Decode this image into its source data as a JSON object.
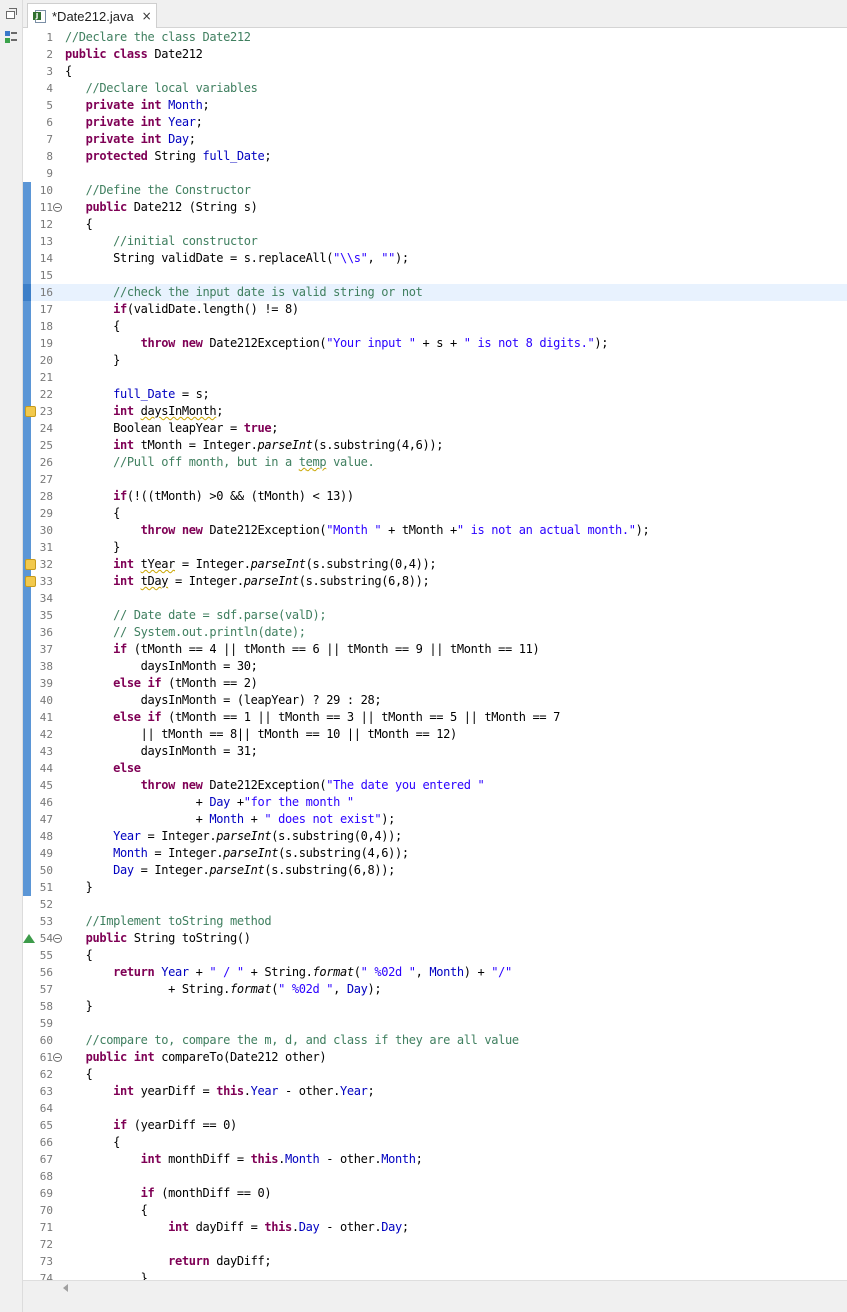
{
  "tab": {
    "title": "*Date212.java",
    "close": "×"
  },
  "lines": [
    {
      "n": "1",
      "code": [
        [
          "cm",
          "//Declare the class Date212"
        ]
      ]
    },
    {
      "n": "2",
      "code": [
        [
          "kw",
          "public"
        ],
        [
          "",
          " "
        ],
        [
          "kw",
          "class"
        ],
        [
          "",
          " Date212"
        ]
      ]
    },
    {
      "n": "3",
      "code": [
        [
          "",
          "{"
        ]
      ]
    },
    {
      "n": "4",
      "code": [
        [
          "",
          "   "
        ],
        [
          "cm",
          "//Declare local variables"
        ]
      ]
    },
    {
      "n": "5",
      "code": [
        [
          "",
          "   "
        ],
        [
          "kw",
          "private"
        ],
        [
          "",
          " "
        ],
        [
          "kw",
          "int"
        ],
        [
          "",
          " "
        ],
        [
          "fd",
          "Month"
        ],
        [
          "",
          ";"
        ]
      ]
    },
    {
      "n": "6",
      "code": [
        [
          "",
          "   "
        ],
        [
          "kw",
          "private"
        ],
        [
          "",
          " "
        ],
        [
          "kw",
          "int"
        ],
        [
          "",
          " "
        ],
        [
          "fd",
          "Year"
        ],
        [
          "",
          ";"
        ]
      ]
    },
    {
      "n": "7",
      "code": [
        [
          "",
          "   "
        ],
        [
          "kw",
          "private"
        ],
        [
          "",
          " "
        ],
        [
          "kw",
          "int"
        ],
        [
          "",
          " "
        ],
        [
          "fd",
          "Day"
        ],
        [
          "",
          ";"
        ]
      ]
    },
    {
      "n": "8",
      "code": [
        [
          "",
          "   "
        ],
        [
          "kw",
          "protected"
        ],
        [
          "",
          " String "
        ],
        [
          "fd",
          "full_Date"
        ],
        [
          "",
          ";"
        ]
      ]
    },
    {
      "n": "9",
      "code": []
    },
    {
      "n": "10",
      "code": [
        [
          "",
          "   "
        ],
        [
          "cm",
          "//Define the Constructor"
        ]
      ]
    },
    {
      "n": "11",
      "code": [
        [
          "",
          "   "
        ],
        [
          "kw",
          "public"
        ],
        [
          "",
          " Date212 (String s)"
        ]
      ]
    },
    {
      "n": "12",
      "code": [
        [
          "",
          "   {"
        ]
      ]
    },
    {
      "n": "13",
      "code": [
        [
          "",
          "       "
        ],
        [
          "cm",
          "//initial constructor"
        ]
      ]
    },
    {
      "n": "14",
      "code": [
        [
          "",
          "       String validDate = s.replaceAll("
        ],
        [
          "st",
          "\"\\\\s\""
        ],
        [
          "",
          ", "
        ],
        [
          "st",
          "\"\""
        ],
        [
          "",
          ");"
        ]
      ]
    },
    {
      "n": "15",
      "code": []
    },
    {
      "n": "16",
      "code": [
        [
          "",
          "       "
        ],
        [
          "cm",
          "//check the input date is valid string or not"
        ]
      ]
    },
    {
      "n": "17",
      "code": [
        [
          "",
          "       "
        ],
        [
          "kw",
          "if"
        ],
        [
          "",
          "(validDate.length() != 8)"
        ]
      ]
    },
    {
      "n": "18",
      "code": [
        [
          "",
          "       {"
        ]
      ]
    },
    {
      "n": "19",
      "code": [
        [
          "",
          "           "
        ],
        [
          "kw",
          "throw"
        ],
        [
          "",
          " "
        ],
        [
          "kw",
          "new"
        ],
        [
          "",
          " Date212Exception("
        ],
        [
          "st",
          "\"Your input \""
        ],
        [
          "",
          " + s + "
        ],
        [
          "st",
          "\" is not 8 digits.\""
        ],
        [
          "",
          ");"
        ]
      ]
    },
    {
      "n": "20",
      "code": [
        [
          "",
          "       }"
        ]
      ]
    },
    {
      "n": "21",
      "code": []
    },
    {
      "n": "22",
      "code": [
        [
          "",
          "       "
        ],
        [
          "fd",
          "full_Date"
        ],
        [
          "",
          " = s;"
        ]
      ]
    },
    {
      "n": "23",
      "code": [
        [
          "",
          "       "
        ],
        [
          "kw",
          "int"
        ],
        [
          "",
          " "
        ],
        [
          "sq",
          "daysInMonth"
        ],
        [
          "",
          ";"
        ]
      ]
    },
    {
      "n": "24",
      "code": [
        [
          "",
          "       Boolean leapYear = "
        ],
        [
          "kw",
          "true"
        ],
        [
          "",
          ";"
        ]
      ]
    },
    {
      "n": "25",
      "code": [
        [
          "",
          "       "
        ],
        [
          "kw",
          "int"
        ],
        [
          "",
          " tMonth = Integer."
        ],
        [
          "it",
          "parseInt"
        ],
        [
          "",
          "(s.substring(4,6));"
        ]
      ]
    },
    {
      "n": "26",
      "code": [
        [
          "",
          "       "
        ],
        [
          "cm",
          "//Pull off month, but in a "
        ],
        [
          "cm sq",
          "temp"
        ],
        [
          "cm",
          " value."
        ]
      ]
    },
    {
      "n": "27",
      "code": []
    },
    {
      "n": "28",
      "code": [
        [
          "",
          "       "
        ],
        [
          "kw",
          "if"
        ],
        [
          "",
          "(!((tMonth) >0 && (tMonth) < 13))"
        ]
      ]
    },
    {
      "n": "29",
      "code": [
        [
          "",
          "       {"
        ]
      ]
    },
    {
      "n": "30",
      "code": [
        [
          "",
          "           "
        ],
        [
          "kw",
          "throw"
        ],
        [
          "",
          " "
        ],
        [
          "kw",
          "new"
        ],
        [
          "",
          " Date212Exception("
        ],
        [
          "st",
          "\"Month \""
        ],
        [
          "",
          " + tMonth +"
        ],
        [
          "st",
          "\" is not an actual month.\""
        ],
        [
          "",
          ");"
        ]
      ]
    },
    {
      "n": "31",
      "code": [
        [
          "",
          "       }"
        ]
      ]
    },
    {
      "n": "32",
      "code": [
        [
          "",
          "       "
        ],
        [
          "kw",
          "int"
        ],
        [
          "",
          " "
        ],
        [
          "sq",
          "tYear"
        ],
        [
          "",
          " = Integer."
        ],
        [
          "it",
          "parseInt"
        ],
        [
          "",
          "(s.substring(0,4));"
        ]
      ]
    },
    {
      "n": "33",
      "code": [
        [
          "",
          "       "
        ],
        [
          "kw",
          "int"
        ],
        [
          "",
          " "
        ],
        [
          "sq",
          "tDay"
        ],
        [
          "",
          " = Integer."
        ],
        [
          "it",
          "parseInt"
        ],
        [
          "",
          "(s.substring(6,8));"
        ]
      ]
    },
    {
      "n": "34",
      "code": []
    },
    {
      "n": "35",
      "code": [
        [
          "",
          "       "
        ],
        [
          "cm",
          "// Date date = sdf.parse(valD);"
        ]
      ]
    },
    {
      "n": "36",
      "code": [
        [
          "",
          "       "
        ],
        [
          "cm",
          "// System.out.println(date);"
        ]
      ]
    },
    {
      "n": "37",
      "code": [
        [
          "",
          "       "
        ],
        [
          "kw",
          "if"
        ],
        [
          "",
          " (tMonth == 4 || tMonth == 6 || tMonth == 9 || tMonth == 11)"
        ]
      ]
    },
    {
      "n": "38",
      "code": [
        [
          "",
          "           daysInMonth = 30;"
        ]
      ]
    },
    {
      "n": "39",
      "code": [
        [
          "",
          "       "
        ],
        [
          "kw",
          "else"
        ],
        [
          "",
          " "
        ],
        [
          "kw",
          "if"
        ],
        [
          "",
          " (tMonth == 2)"
        ]
      ]
    },
    {
      "n": "40",
      "code": [
        [
          "",
          "           daysInMonth = (leapYear) ? 29 : 28;"
        ]
      ]
    },
    {
      "n": "41",
      "code": [
        [
          "",
          "       "
        ],
        [
          "kw",
          "else"
        ],
        [
          "",
          " "
        ],
        [
          "kw",
          "if"
        ],
        [
          "",
          " (tMonth == 1 || tMonth == 3 || tMonth == 5 || tMonth == 7"
        ]
      ]
    },
    {
      "n": "42",
      "code": [
        [
          "",
          "           || tMonth == 8|| tMonth == 10 || tMonth == 12)"
        ]
      ]
    },
    {
      "n": "43",
      "code": [
        [
          "",
          "           daysInMonth = 31;"
        ]
      ]
    },
    {
      "n": "44",
      "code": [
        [
          "",
          "       "
        ],
        [
          "kw",
          "else"
        ]
      ]
    },
    {
      "n": "45",
      "code": [
        [
          "",
          "           "
        ],
        [
          "kw",
          "throw"
        ],
        [
          "",
          " "
        ],
        [
          "kw",
          "new"
        ],
        [
          "",
          " Date212Exception("
        ],
        [
          "st",
          "\"The date you entered \""
        ]
      ]
    },
    {
      "n": "46",
      "code": [
        [
          "",
          "                   + "
        ],
        [
          "fd",
          "Day"
        ],
        [
          "",
          " +"
        ],
        [
          "st",
          "\"for the month \""
        ]
      ]
    },
    {
      "n": "47",
      "code": [
        [
          "",
          "                   + "
        ],
        [
          "fd",
          "Month"
        ],
        [
          "",
          " + "
        ],
        [
          "st",
          "\" does not exist\""
        ],
        [
          "",
          ");"
        ]
      ]
    },
    {
      "n": "48",
      "code": [
        [
          "",
          "       "
        ],
        [
          "fd",
          "Year"
        ],
        [
          "",
          " = Integer."
        ],
        [
          "it",
          "parseInt"
        ],
        [
          "",
          "(s.substring(0,4));"
        ]
      ]
    },
    {
      "n": "49",
      "code": [
        [
          "",
          "       "
        ],
        [
          "fd",
          "Month"
        ],
        [
          "",
          " = Integer."
        ],
        [
          "it",
          "parseInt"
        ],
        [
          "",
          "(s.substring(4,6));"
        ]
      ]
    },
    {
      "n": "50",
      "code": [
        [
          "",
          "       "
        ],
        [
          "fd",
          "Day"
        ],
        [
          "",
          " = Integer."
        ],
        [
          "it",
          "parseInt"
        ],
        [
          "",
          "(s.substring(6,8));"
        ]
      ]
    },
    {
      "n": "51",
      "code": [
        [
          "",
          "   }"
        ]
      ]
    },
    {
      "n": "52",
      "code": []
    },
    {
      "n": "53",
      "code": [
        [
          "",
          "   "
        ],
        [
          "cm",
          "//Implement toString method"
        ]
      ]
    },
    {
      "n": "54",
      "code": [
        [
          "",
          "   "
        ],
        [
          "kw",
          "public"
        ],
        [
          "",
          " String toString()"
        ]
      ]
    },
    {
      "n": "55",
      "code": [
        [
          "",
          "   {"
        ]
      ]
    },
    {
      "n": "56",
      "code": [
        [
          "",
          "       "
        ],
        [
          "kw",
          "return"
        ],
        [
          "",
          " "
        ],
        [
          "fd",
          "Year"
        ],
        [
          "",
          " + "
        ],
        [
          "st",
          "\" / \""
        ],
        [
          "",
          " + String."
        ],
        [
          "it",
          "format"
        ],
        [
          "",
          "("
        ],
        [
          "st",
          "\" %02d \""
        ],
        [
          "",
          ", "
        ],
        [
          "fd",
          "Month"
        ],
        [
          "",
          ") + "
        ],
        [
          "st",
          "\"/\""
        ]
      ]
    },
    {
      "n": "57",
      "code": [
        [
          "",
          "               + String."
        ],
        [
          "it",
          "format"
        ],
        [
          "",
          "("
        ],
        [
          "st",
          "\" %02d \""
        ],
        [
          "",
          ", "
        ],
        [
          "fd",
          "Day"
        ],
        [
          "",
          ");"
        ]
      ]
    },
    {
      "n": "58",
      "code": [
        [
          "",
          "   }"
        ]
      ]
    },
    {
      "n": "59",
      "code": []
    },
    {
      "n": "60",
      "code": [
        [
          "",
          "   "
        ],
        [
          "cm",
          "//compare to, compare the m, d, and class if they are all value"
        ]
      ]
    },
    {
      "n": "61",
      "code": [
        [
          "",
          "   "
        ],
        [
          "kw",
          "public"
        ],
        [
          "",
          " "
        ],
        [
          "kw",
          "int"
        ],
        [
          "",
          " compareTo(Date212 other)"
        ]
      ]
    },
    {
      "n": "62",
      "code": [
        [
          "",
          "   {"
        ]
      ]
    },
    {
      "n": "63",
      "code": [
        [
          "",
          "       "
        ],
        [
          "kw",
          "int"
        ],
        [
          "",
          " yearDiff = "
        ],
        [
          "kw",
          "this"
        ],
        [
          "",
          "."
        ],
        [
          "fd",
          "Year"
        ],
        [
          "",
          " - other."
        ],
        [
          "fd",
          "Year"
        ],
        [
          "",
          ";"
        ]
      ]
    },
    {
      "n": "64",
      "code": []
    },
    {
      "n": "65",
      "code": [
        [
          "",
          "       "
        ],
        [
          "kw",
          "if"
        ],
        [
          "",
          " (yearDiff == 0)"
        ]
      ]
    },
    {
      "n": "66",
      "code": [
        [
          "",
          "       {"
        ]
      ]
    },
    {
      "n": "67",
      "code": [
        [
          "",
          "           "
        ],
        [
          "kw",
          "int"
        ],
        [
          "",
          " monthDiff = "
        ],
        [
          "kw",
          "this"
        ],
        [
          "",
          "."
        ],
        [
          "fd",
          "Month"
        ],
        [
          "",
          " - other."
        ],
        [
          "fd",
          "Month"
        ],
        [
          "",
          ";"
        ]
      ]
    },
    {
      "n": "68",
      "code": []
    },
    {
      "n": "69",
      "code": [
        [
          "",
          "           "
        ],
        [
          "kw",
          "if"
        ],
        [
          "",
          " (monthDiff == 0)"
        ]
      ]
    },
    {
      "n": "70",
      "code": [
        [
          "",
          "           {"
        ]
      ]
    },
    {
      "n": "71",
      "code": [
        [
          "",
          "               "
        ],
        [
          "kw",
          "int"
        ],
        [
          "",
          " dayDiff = "
        ],
        [
          "kw",
          "this"
        ],
        [
          "",
          "."
        ],
        [
          "fd",
          "Day"
        ],
        [
          "",
          " - other."
        ],
        [
          "fd",
          "Day"
        ],
        [
          "",
          ";"
        ]
      ]
    },
    {
      "n": "72",
      "code": []
    },
    {
      "n": "73",
      "code": [
        [
          "",
          "               "
        ],
        [
          "kw",
          "return"
        ],
        [
          "",
          " dayDiff;"
        ]
      ]
    },
    {
      "n": "74",
      "code": [
        [
          "",
          "           }"
        ]
      ]
    }
  ],
  "changed_lines": [
    10,
    11,
    12,
    13,
    14,
    15,
    16,
    17,
    18,
    19,
    20,
    21,
    22,
    23,
    24,
    25,
    26,
    27,
    28,
    29,
    30,
    31,
    32,
    33,
    34,
    35,
    36,
    37,
    38,
    39,
    40,
    41,
    42,
    43,
    44,
    45,
    46,
    47,
    48,
    49,
    50,
    51
  ],
  "fold_lines": [
    11,
    54,
    61
  ],
  "warning_lines": [
    23,
    32,
    33
  ],
  "override_lines": [
    54
  ],
  "highlighted_line": 16,
  "colors": {
    "keyword": "#7f0055",
    "comment": "#3f7f5f",
    "string": "#2a00ff",
    "field": "#0000c0",
    "change_bar": "#5b96d6",
    "line_highlight": "#e8f2fe"
  }
}
